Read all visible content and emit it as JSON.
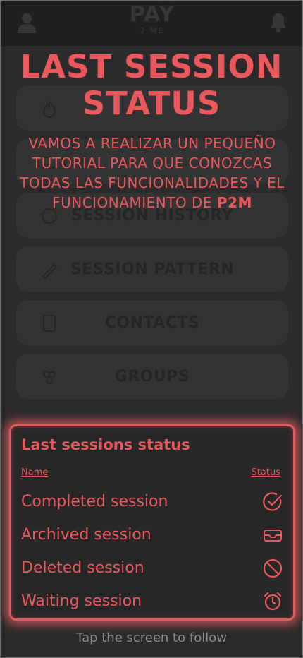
{
  "header": {
    "logo_main": "PAY",
    "logo_sub": "2 ME",
    "user_icon": "user-icon",
    "bell_icon": "bell-icon"
  },
  "menu": [
    {
      "label": "",
      "icon": "fire-icon"
    },
    {
      "label": "",
      "icon": "card-icon"
    },
    {
      "label": "SESSION HISTORY",
      "icon": "history-icon"
    },
    {
      "label": "SESSION PATTERN",
      "icon": "pattern-icon"
    },
    {
      "label": "CONTACTS",
      "icon": "contacts-icon"
    },
    {
      "label": "GROUPS",
      "icon": "groups-icon"
    }
  ],
  "tutorial": {
    "title": "LAST SESSION STATUS",
    "text_main": "VAMOS A REALIZAR UN PEQUEÑO TUTORIAL PARA QUE CONOZCAS TODAS LAS FUNCIONALIDADES Y EL FUNCIONAMIENTO DE",
    "text_bold": "P2M"
  },
  "status_panel": {
    "title": "Last sessions status",
    "col_name": "Name",
    "col_status": "Status",
    "rows": [
      {
        "label": "Completed session",
        "icon": "check-circle-icon"
      },
      {
        "label": "Archived session",
        "icon": "inbox-icon"
      },
      {
        "label": "Deleted session",
        "icon": "ban-icon"
      },
      {
        "label": "Waiting session",
        "icon": "alarm-clock-icon"
      }
    ]
  },
  "footer": {
    "hint": "Tap the screen to follow"
  },
  "colors": {
    "accent": "#e8585c",
    "background": "#3a3a3a"
  }
}
